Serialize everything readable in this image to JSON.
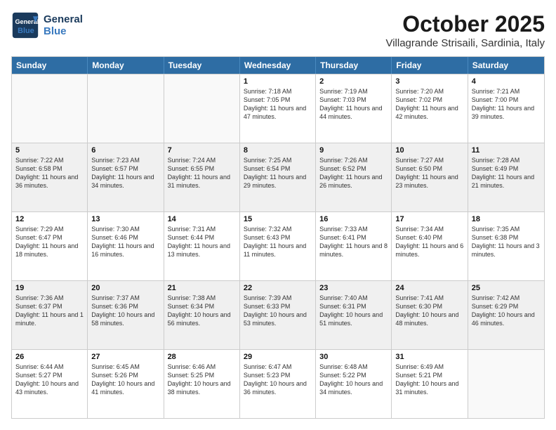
{
  "header": {
    "logo_line1": "General",
    "logo_line2": "Blue",
    "main_title": "October 2025",
    "subtitle": "Villagrande Strisaili, Sardinia, Italy"
  },
  "weekdays": [
    "Sunday",
    "Monday",
    "Tuesday",
    "Wednesday",
    "Thursday",
    "Friday",
    "Saturday"
  ],
  "rows": [
    [
      {
        "day": "",
        "info": "",
        "shaded": false,
        "empty": true
      },
      {
        "day": "",
        "info": "",
        "shaded": false,
        "empty": true
      },
      {
        "day": "",
        "info": "",
        "shaded": false,
        "empty": true
      },
      {
        "day": "1",
        "info": "Sunrise: 7:18 AM\nSunset: 7:05 PM\nDaylight: 11 hours and 47 minutes.",
        "shaded": false,
        "empty": false
      },
      {
        "day": "2",
        "info": "Sunrise: 7:19 AM\nSunset: 7:03 PM\nDaylight: 11 hours and 44 minutes.",
        "shaded": false,
        "empty": false
      },
      {
        "day": "3",
        "info": "Sunrise: 7:20 AM\nSunset: 7:02 PM\nDaylight: 11 hours and 42 minutes.",
        "shaded": false,
        "empty": false
      },
      {
        "day": "4",
        "info": "Sunrise: 7:21 AM\nSunset: 7:00 PM\nDaylight: 11 hours and 39 minutes.",
        "shaded": false,
        "empty": false
      }
    ],
    [
      {
        "day": "5",
        "info": "Sunrise: 7:22 AM\nSunset: 6:58 PM\nDaylight: 11 hours and 36 minutes.",
        "shaded": true,
        "empty": false
      },
      {
        "day": "6",
        "info": "Sunrise: 7:23 AM\nSunset: 6:57 PM\nDaylight: 11 hours and 34 minutes.",
        "shaded": true,
        "empty": false
      },
      {
        "day": "7",
        "info": "Sunrise: 7:24 AM\nSunset: 6:55 PM\nDaylight: 11 hours and 31 minutes.",
        "shaded": true,
        "empty": false
      },
      {
        "day": "8",
        "info": "Sunrise: 7:25 AM\nSunset: 6:54 PM\nDaylight: 11 hours and 29 minutes.",
        "shaded": true,
        "empty": false
      },
      {
        "day": "9",
        "info": "Sunrise: 7:26 AM\nSunset: 6:52 PM\nDaylight: 11 hours and 26 minutes.",
        "shaded": true,
        "empty": false
      },
      {
        "day": "10",
        "info": "Sunrise: 7:27 AM\nSunset: 6:50 PM\nDaylight: 11 hours and 23 minutes.",
        "shaded": true,
        "empty": false
      },
      {
        "day": "11",
        "info": "Sunrise: 7:28 AM\nSunset: 6:49 PM\nDaylight: 11 hours and 21 minutes.",
        "shaded": true,
        "empty": false
      }
    ],
    [
      {
        "day": "12",
        "info": "Sunrise: 7:29 AM\nSunset: 6:47 PM\nDaylight: 11 hours and 18 minutes.",
        "shaded": false,
        "empty": false
      },
      {
        "day": "13",
        "info": "Sunrise: 7:30 AM\nSunset: 6:46 PM\nDaylight: 11 hours and 16 minutes.",
        "shaded": false,
        "empty": false
      },
      {
        "day": "14",
        "info": "Sunrise: 7:31 AM\nSunset: 6:44 PM\nDaylight: 11 hours and 13 minutes.",
        "shaded": false,
        "empty": false
      },
      {
        "day": "15",
        "info": "Sunrise: 7:32 AM\nSunset: 6:43 PM\nDaylight: 11 hours and 11 minutes.",
        "shaded": false,
        "empty": false
      },
      {
        "day": "16",
        "info": "Sunrise: 7:33 AM\nSunset: 6:41 PM\nDaylight: 11 hours and 8 minutes.",
        "shaded": false,
        "empty": false
      },
      {
        "day": "17",
        "info": "Sunrise: 7:34 AM\nSunset: 6:40 PM\nDaylight: 11 hours and 6 minutes.",
        "shaded": false,
        "empty": false
      },
      {
        "day": "18",
        "info": "Sunrise: 7:35 AM\nSunset: 6:38 PM\nDaylight: 11 hours and 3 minutes.",
        "shaded": false,
        "empty": false
      }
    ],
    [
      {
        "day": "19",
        "info": "Sunrise: 7:36 AM\nSunset: 6:37 PM\nDaylight: 11 hours and 1 minute.",
        "shaded": true,
        "empty": false
      },
      {
        "day": "20",
        "info": "Sunrise: 7:37 AM\nSunset: 6:36 PM\nDaylight: 10 hours and 58 minutes.",
        "shaded": true,
        "empty": false
      },
      {
        "day": "21",
        "info": "Sunrise: 7:38 AM\nSunset: 6:34 PM\nDaylight: 10 hours and 56 minutes.",
        "shaded": true,
        "empty": false
      },
      {
        "day": "22",
        "info": "Sunrise: 7:39 AM\nSunset: 6:33 PM\nDaylight: 10 hours and 53 minutes.",
        "shaded": true,
        "empty": false
      },
      {
        "day": "23",
        "info": "Sunrise: 7:40 AM\nSunset: 6:31 PM\nDaylight: 10 hours and 51 minutes.",
        "shaded": true,
        "empty": false
      },
      {
        "day": "24",
        "info": "Sunrise: 7:41 AM\nSunset: 6:30 PM\nDaylight: 10 hours and 48 minutes.",
        "shaded": true,
        "empty": false
      },
      {
        "day": "25",
        "info": "Sunrise: 7:42 AM\nSunset: 6:29 PM\nDaylight: 10 hours and 46 minutes.",
        "shaded": true,
        "empty": false
      }
    ],
    [
      {
        "day": "26",
        "info": "Sunrise: 6:44 AM\nSunset: 5:27 PM\nDaylight: 10 hours and 43 minutes.",
        "shaded": false,
        "empty": false
      },
      {
        "day": "27",
        "info": "Sunrise: 6:45 AM\nSunset: 5:26 PM\nDaylight: 10 hours and 41 minutes.",
        "shaded": false,
        "empty": false
      },
      {
        "day": "28",
        "info": "Sunrise: 6:46 AM\nSunset: 5:25 PM\nDaylight: 10 hours and 38 minutes.",
        "shaded": false,
        "empty": false
      },
      {
        "day": "29",
        "info": "Sunrise: 6:47 AM\nSunset: 5:23 PM\nDaylight: 10 hours and 36 minutes.",
        "shaded": false,
        "empty": false
      },
      {
        "day": "30",
        "info": "Sunrise: 6:48 AM\nSunset: 5:22 PM\nDaylight: 10 hours and 34 minutes.",
        "shaded": false,
        "empty": false
      },
      {
        "day": "31",
        "info": "Sunrise: 6:49 AM\nSunset: 5:21 PM\nDaylight: 10 hours and 31 minutes.",
        "shaded": false,
        "empty": false
      },
      {
        "day": "",
        "info": "",
        "shaded": false,
        "empty": true
      }
    ]
  ]
}
